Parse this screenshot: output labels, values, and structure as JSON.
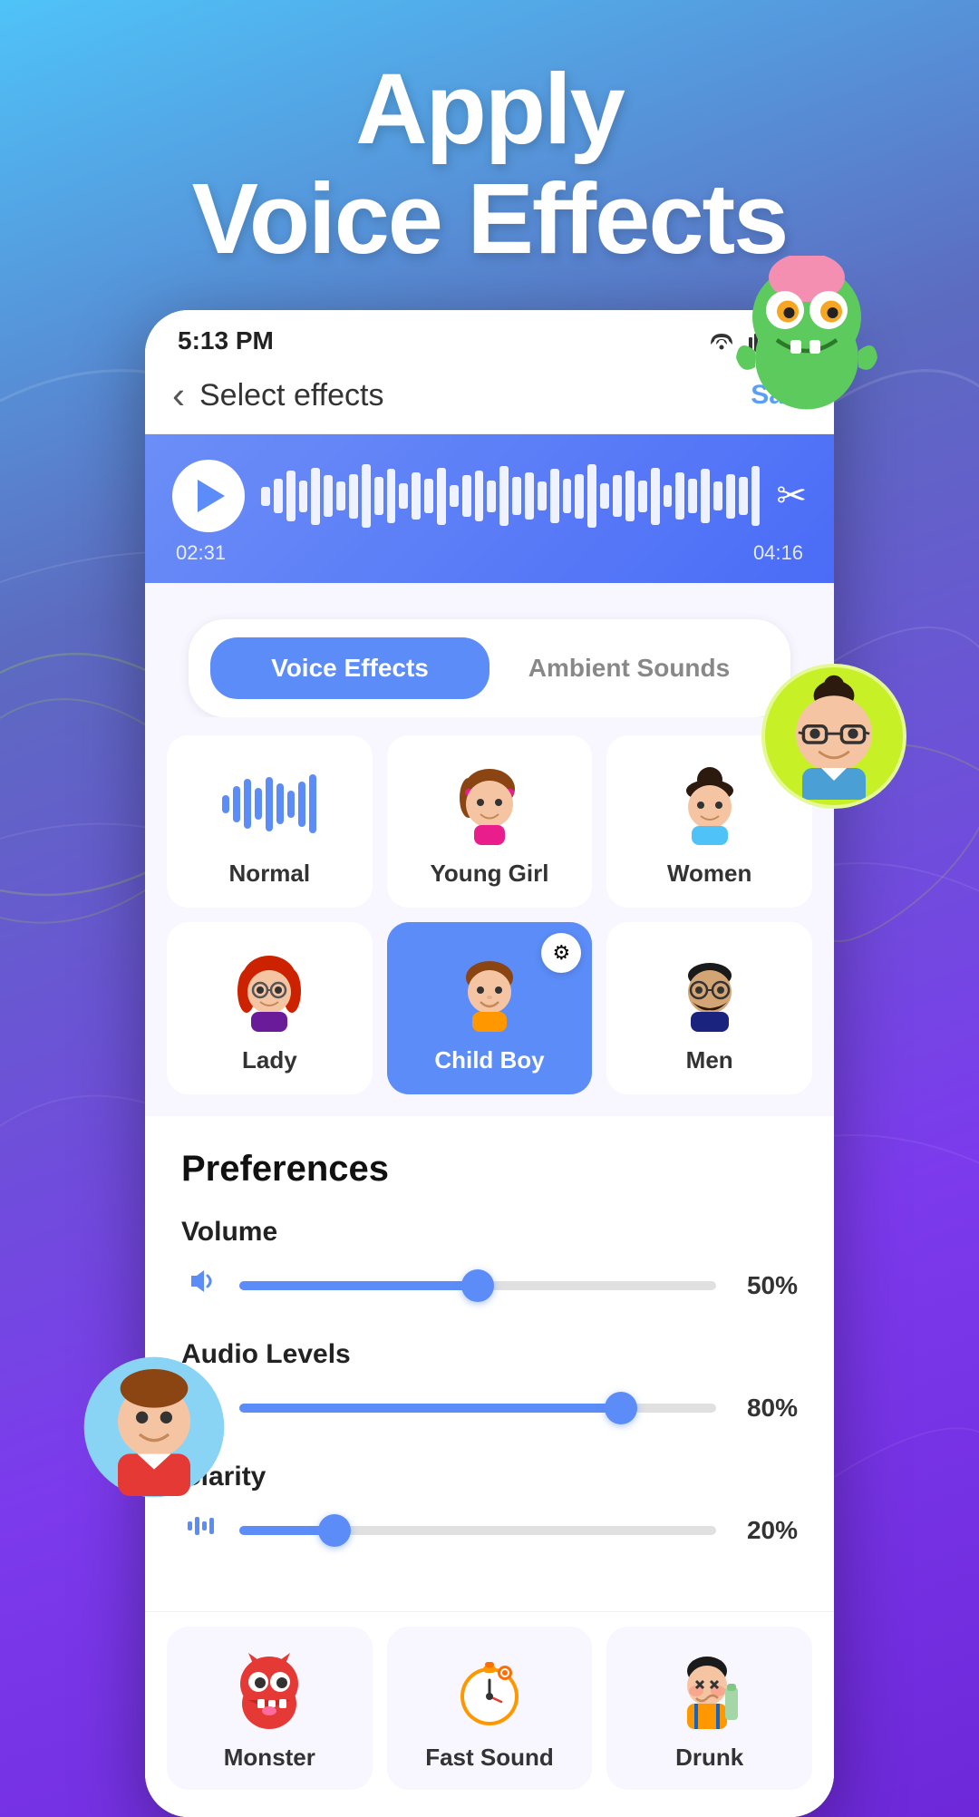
{
  "header": {
    "title_line1": "Apply",
    "title_line2": "Voice Effects"
  },
  "status_bar": {
    "time": "5:13 PM",
    "wifi": "📶",
    "signal": "📶",
    "battery": "🔋"
  },
  "nav": {
    "back_icon": "‹",
    "title": "Select effects",
    "save_label": "Sa..."
  },
  "audio_player": {
    "timestamp_current": "02:31",
    "timestamp_total": "04:16"
  },
  "tabs": [
    {
      "id": "voice-effects",
      "label": "Voice Effects",
      "active": true
    },
    {
      "id": "ambient-sounds",
      "label": "Ambient Sounds",
      "active": false
    }
  ],
  "effects": [
    {
      "id": "normal",
      "label": "Normal",
      "active": false,
      "icon": "wave"
    },
    {
      "id": "young-girl",
      "label": "Young Girl",
      "active": false,
      "icon": "young-girl"
    },
    {
      "id": "women",
      "label": "Women",
      "active": false,
      "icon": "women"
    },
    {
      "id": "lady",
      "label": "Lady",
      "active": false,
      "icon": "lady"
    },
    {
      "id": "child-boy",
      "label": "Child Boy",
      "active": true,
      "icon": "child-boy"
    },
    {
      "id": "men",
      "label": "Men",
      "active": false,
      "icon": "men"
    }
  ],
  "preferences": {
    "title": "Preferences",
    "sliders": [
      {
        "id": "volume",
        "label": "Volume",
        "value": 50,
        "display": "50%",
        "icon": "🔊"
      },
      {
        "id": "audio-levels",
        "label": "Audio Levels",
        "value": 80,
        "display": "80%",
        "icon": "〜"
      },
      {
        "id": "clarity",
        "label": "Clarity",
        "value": 20,
        "display": "20%",
        "icon": "〜"
      }
    ]
  },
  "bottom_effects": [
    {
      "id": "monster",
      "label": "Monster",
      "icon": "👾"
    },
    {
      "id": "fast-sound",
      "label": "Fast Sound",
      "icon": "⏱"
    },
    {
      "id": "drunk",
      "label": "Drunk",
      "icon": "🍺"
    }
  ],
  "decorative": {
    "monster_emoji": "👾",
    "avatar_emoji": "🧑‍💻",
    "boy_emoji": "👦"
  }
}
